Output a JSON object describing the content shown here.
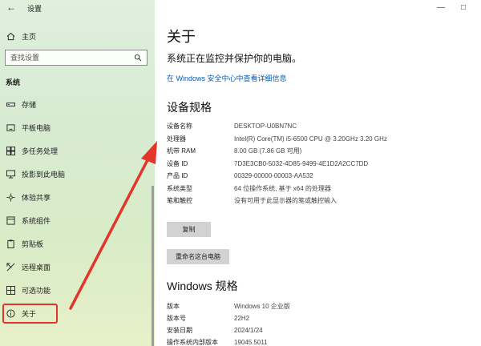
{
  "window": {
    "app_title": "设置",
    "back_glyph": "←",
    "minimize_glyph": "—",
    "maximize_glyph": "□"
  },
  "sidebar": {
    "home_label": "主页",
    "search_placeholder": "查找设置",
    "section_label": "系统",
    "items": [
      {
        "label": "存储",
        "icon": "storage-icon"
      },
      {
        "label": "平板电脑",
        "icon": "tablet-icon"
      },
      {
        "label": "多任务处理",
        "icon": "multitask-icon"
      },
      {
        "label": "投影到此电脑",
        "icon": "project-icon"
      },
      {
        "label": "体验共享",
        "icon": "share-icon"
      },
      {
        "label": "系统组件",
        "icon": "components-icon"
      },
      {
        "label": "剪贴板",
        "icon": "clipboard-icon"
      },
      {
        "label": "远程桌面",
        "icon": "remote-desktop-icon"
      },
      {
        "label": "可选功能",
        "icon": "optional-features-icon"
      },
      {
        "label": "关于",
        "icon": "info-icon"
      }
    ],
    "active_item": "关于"
  },
  "main": {
    "title": "关于",
    "protect_text": "系统正在监控并保护你的电脑。",
    "security_link": "在 Windows 安全中心中查看详细信息",
    "device_specs": {
      "heading": "设备规格",
      "rows": [
        {
          "key": "设备名称",
          "value": "DESKTOP-U0BN7NC"
        },
        {
          "key": "处理器",
          "value": "Intel(R) Core(TM) i5-6500 CPU @ 3.20GHz   3.20 GHz"
        },
        {
          "key": "机带 RAM",
          "value": "8.00 GB (7.86 GB 可用)"
        },
        {
          "key": "设备 ID",
          "value": "7D3E3CB0-5032-4D85-9499-4E1D2A2CC7DD"
        },
        {
          "key": "产品 ID",
          "value": "00329-00000-00003-AA532"
        },
        {
          "key": "系统类型",
          "value": "64 位操作系统, 基于 x64 的处理器"
        },
        {
          "key": "笔和触控",
          "value": "没有可用于此显示器的笔或触控输入"
        }
      ],
      "copy_button": "复制",
      "rename_button": "重命名这台电脑"
    },
    "windows_specs": {
      "heading": "Windows 规格",
      "rows": [
        {
          "key": "版本",
          "value": "Windows 10 企业版"
        },
        {
          "key": "版本号",
          "value": "22H2"
        },
        {
          "key": "安装日期",
          "value": "2024/1/24"
        },
        {
          "key": "操作系统内部版本",
          "value": "19045.5011"
        }
      ]
    }
  },
  "annotation": {
    "color": "#e3352a"
  }
}
